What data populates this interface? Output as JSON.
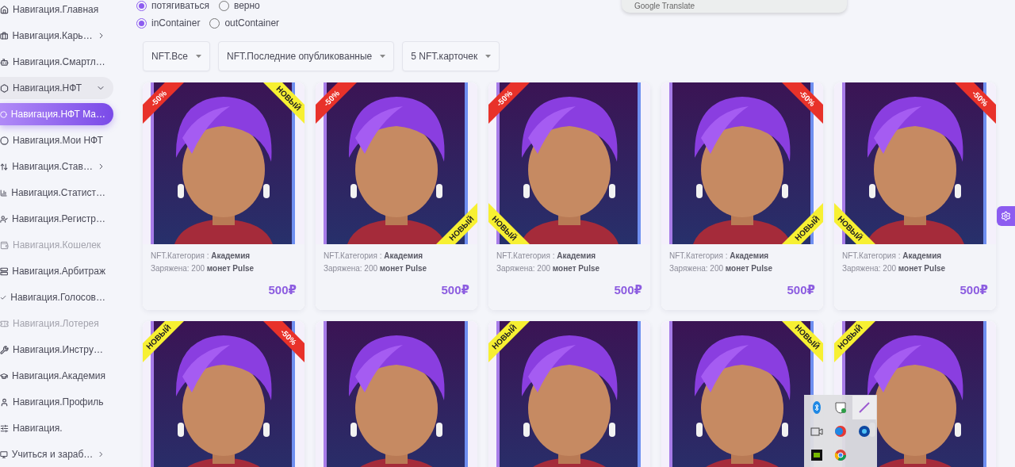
{
  "popup": {
    "text": "Google Translate"
  },
  "sidebar": {
    "items": [
      {
        "label": "Навигация.Главная",
        "selected": false,
        "disabled": false
      },
      {
        "label": "Навигация.Карь…",
        "selected": false,
        "disabled": false,
        "expanded": false
      },
      {
        "label": "Навигация.Смартл…",
        "selected": false,
        "disabled": false
      },
      {
        "label": "Навигация.НФТ",
        "selected": false,
        "disabled": false,
        "expanded": true,
        "children": [
          {
            "label": "Навигация.НФТ Ма…",
            "selected": true,
            "disabled": false
          },
          {
            "label": "Навигация.Мои НФТ",
            "selected": false,
            "disabled": false
          }
        ]
      },
      {
        "label": "Навигация.Став…",
        "selected": false,
        "disabled": false,
        "expanded": false
      },
      {
        "label": "Навигация.Статист…",
        "selected": false,
        "disabled": false
      },
      {
        "label": "Навигация.Регистр…",
        "selected": false,
        "disabled": false
      },
      {
        "label": "Навигация.Кошелек",
        "selected": false,
        "disabled": true
      },
      {
        "label": "Навигация.Арбитраж",
        "selected": false,
        "disabled": false
      },
      {
        "label": "Навигация.Голосов…",
        "selected": false,
        "disabled": false
      },
      {
        "label": "Навигация.Лотерея",
        "selected": false,
        "disabled": true
      },
      {
        "label": "Навигация.Инстру…",
        "selected": false,
        "disabled": false
      },
      {
        "label": "Навигация.Академия",
        "selected": false,
        "disabled": false
      },
      {
        "label": "Навигация.Профиль",
        "selected": false,
        "disabled": false
      },
      {
        "label": "Навигация.",
        "selected": false,
        "disabled": false
      },
      {
        "label": "Учиться и зараб…",
        "selected": false,
        "disabled": false,
        "expanded": false
      }
    ]
  },
  "radio_groups": [
    {
      "options": [
        {
          "label": "потягиваться",
          "selected": true
        },
        {
          "label": "верно",
          "selected": false
        }
      ]
    },
    {
      "options": [
        {
          "label": "inContainer",
          "selected": true
        },
        {
          "label": "outContainer",
          "selected": false
        }
      ]
    }
  ],
  "filters": [
    {
      "label": "NFT.Все"
    },
    {
      "label": "NFT.Последние опубликованные"
    },
    {
      "label": "5 NFT.карточек"
    }
  ],
  "cards": [
    {
      "kind": "nft",
      "badges": [
        {
          "kind": "discount",
          "text": "-50%",
          "top": true,
          "left": true
        },
        {
          "kind": "new",
          "text": "НОВЫЙ",
          "top": true,
          "left": false
        }
      ],
      "category": "NFT.Категория : **Академия**",
      "charge": "Заряжена: 200 **монет Pulse**",
      "price": "500₽"
    },
    {
      "kind": "nft",
      "badges": [
        {
          "kind": "discount",
          "text": "-50%",
          "top": true,
          "left": true
        },
        {
          "kind": "new",
          "text": "НОВЫЙ",
          "top": false,
          "left": false
        }
      ],
      "category": "NFT.Категория : **Академия**",
      "charge": "Заряжена: 200 **монет Pulse**",
      "price": "500₽"
    },
    {
      "kind": "nft",
      "badges": [
        {
          "kind": "discount",
          "text": "-50%",
          "top": true,
          "left": true
        },
        {
          "kind": "new",
          "text": "НОВЫЙ",
          "top": false,
          "left": true
        }
      ],
      "category": "NFT.Категория : **Академия**",
      "charge": "Заряжена: 200 **монет Pulse**",
      "price": "500₽"
    },
    {
      "kind": "nft",
      "badges": [
        {
          "kind": "discount",
          "text": "-50%",
          "top": true,
          "left": false
        },
        {
          "kind": "new",
          "text": "НОВЫЙ",
          "top": false,
          "left": false
        }
      ],
      "category": "NFT.Категория : **Академия**",
      "charge": "Заряжена: 200 **монет Pulse**",
      "price": "500₽"
    },
    {
      "kind": "nft",
      "badges": [
        {
          "kind": "discount",
          "text": "-50%",
          "top": true,
          "left": false
        },
        {
          "kind": "new",
          "text": "НОВЫЙ",
          "top": false,
          "left": true
        }
      ],
      "category": "NFT.Категория : **Академия**",
      "charge": "Заряжена: 200 **монет Pulse**",
      "price": "500₽"
    },
    {
      "kind": "nft",
      "badges": [
        {
          "kind": "new",
          "text": "НОВЫЙ",
          "top": true,
          "left": true
        },
        {
          "kind": "discount",
          "text": "-50%",
          "top": true,
          "left": false
        }
      ]
    },
    {
      "kind": "nft"
    },
    {
      "kind": "nft",
      "badges": [
        {
          "kind": "new",
          "text": "НОВЫЙ",
          "top": true,
          "left": true
        }
      ]
    },
    {
      "kind": "nft",
      "badges": [
        {
          "kind": "new",
          "text": "НОВЫЙ",
          "top": true,
          "left": false
        }
      ]
    },
    {
      "kind": "nft",
      "badges": [
        {
          "kind": "new",
          "text": "НОВЫЙ",
          "top": true,
          "left": true
        }
      ]
    }
  ]
}
